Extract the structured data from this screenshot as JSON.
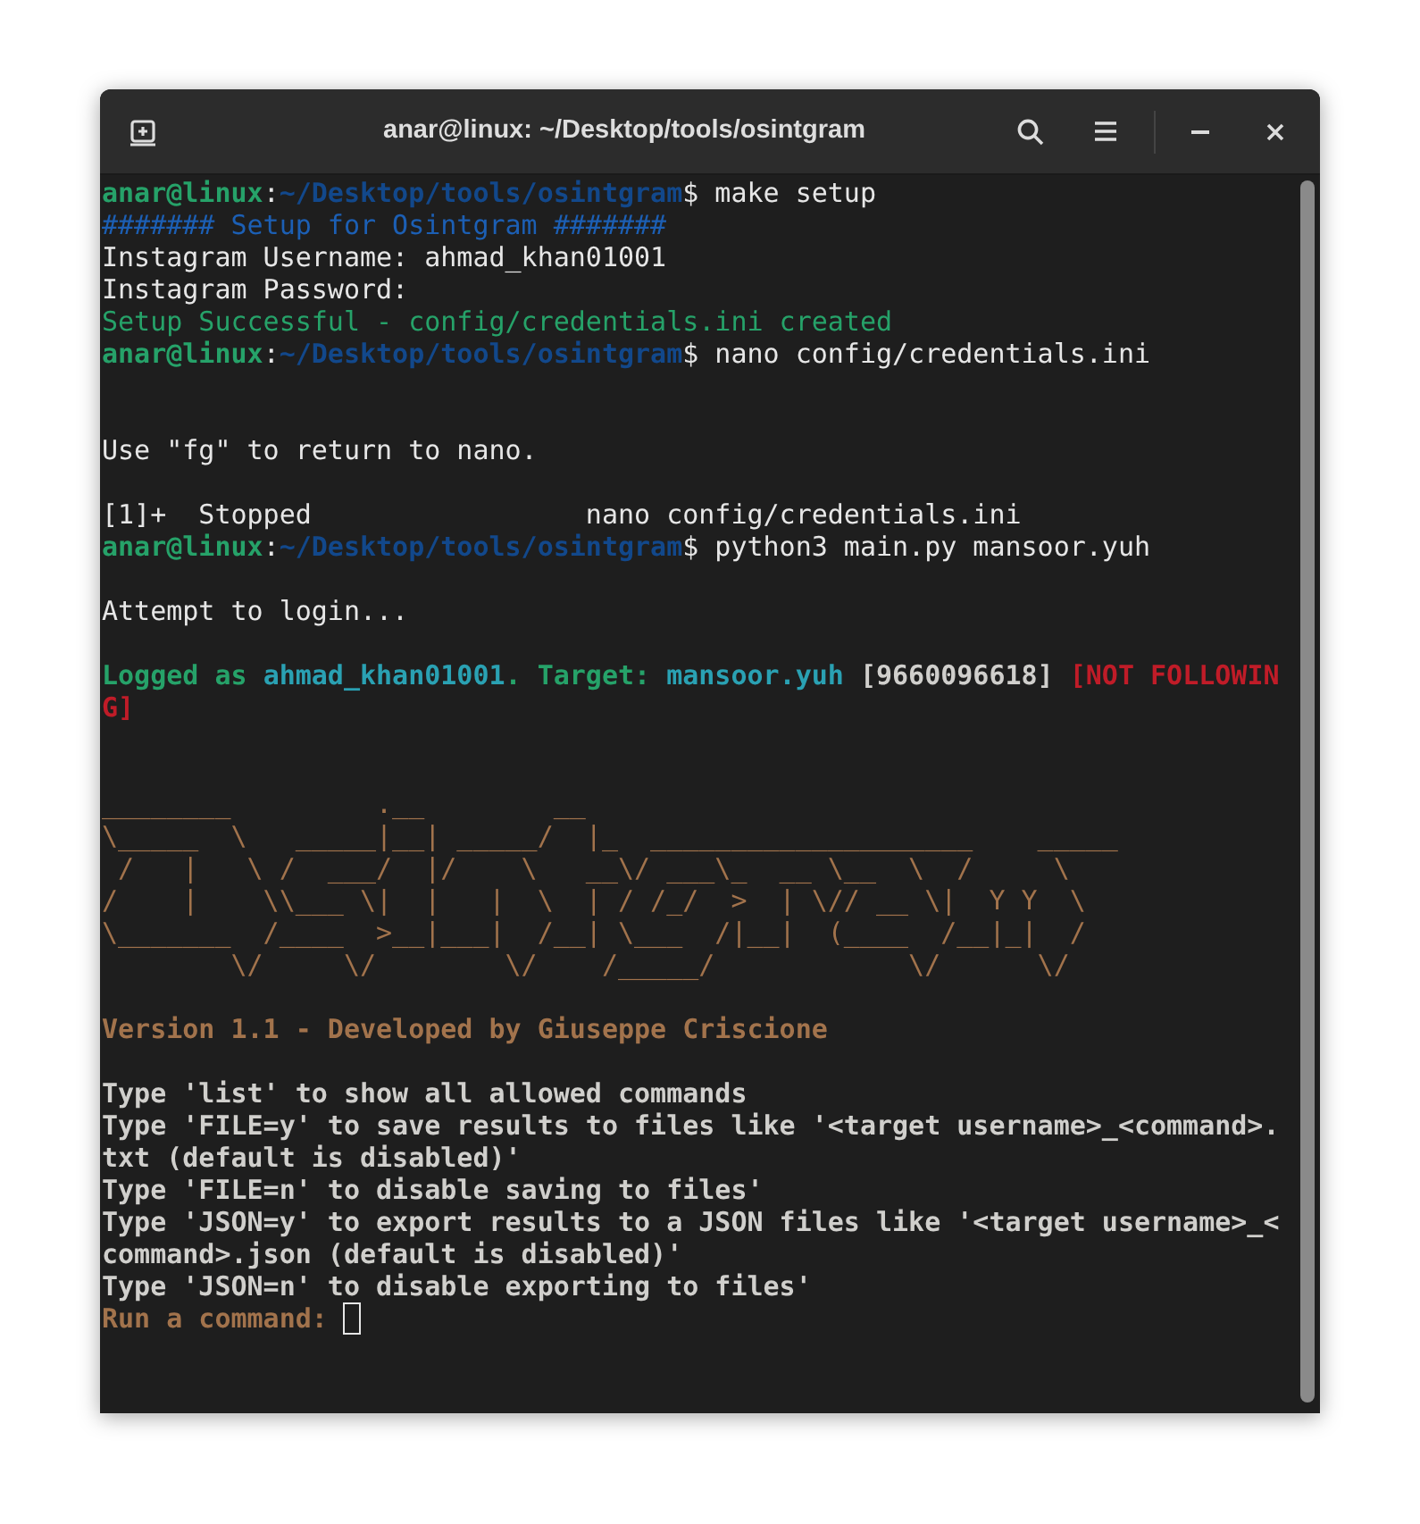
{
  "window": {
    "title": "anar@linux: ~/Desktop/tools/osintgram"
  },
  "terminal": {
    "lines": [
      {
        "kind": "text",
        "segments": [
          {
            "kind": "user",
            "text": "anar@linux"
          },
          {
            "kind": "plain",
            "text": ":"
          },
          {
            "kind": "path",
            "text": "~/Desktop/tools/osintgram"
          },
          {
            "kind": "plain",
            "text": "$ make setup"
          }
        ]
      },
      {
        "kind": "text",
        "segments": [
          {
            "kind": "comment",
            "text": "####### Setup for Osintgram #######"
          }
        ]
      },
      {
        "kind": "text",
        "segments": [
          {
            "kind": "plain",
            "text": "Instagram Username: ahmad_khan01001"
          }
        ]
      },
      {
        "kind": "text",
        "segments": [
          {
            "kind": "plain",
            "text": "Instagram Password:"
          }
        ]
      },
      {
        "kind": "text",
        "segments": [
          {
            "kind": "success",
            "text": "Setup Successful - config/credentials.ini created"
          }
        ]
      },
      {
        "kind": "text",
        "segments": [
          {
            "kind": "user",
            "text": "anar@linux"
          },
          {
            "kind": "plain",
            "text": ":"
          },
          {
            "kind": "path",
            "text": "~/Desktop/tools/osintgram"
          },
          {
            "kind": "plain",
            "text": "$ nano config/credentials.ini"
          }
        ]
      },
      {
        "kind": "blank"
      },
      {
        "kind": "blank"
      },
      {
        "kind": "text",
        "segments": [
          {
            "kind": "plain",
            "text": "Use \"fg\" to return to nano."
          }
        ]
      },
      {
        "kind": "blank"
      },
      {
        "kind": "text",
        "segments": [
          {
            "kind": "plain",
            "text": "[1]+  Stopped                 nano config/credentials.ini"
          }
        ]
      },
      {
        "kind": "text",
        "segments": [
          {
            "kind": "user",
            "text": "anar@linux"
          },
          {
            "kind": "plain",
            "text": ":"
          },
          {
            "kind": "path",
            "text": "~/Desktop/tools/osintgram"
          },
          {
            "kind": "plain",
            "text": "$ python3 main.py mansoor.yuh"
          }
        ]
      },
      {
        "kind": "blank"
      },
      {
        "kind": "text",
        "segments": [
          {
            "kind": "plain",
            "text": "Attempt to login..."
          }
        ]
      },
      {
        "kind": "blank"
      },
      {
        "kind": "text",
        "segments": [
          {
            "kind": "info",
            "text": "Logged as "
          },
          {
            "kind": "account",
            "text": "ahmad_khan01001"
          },
          {
            "kind": "info",
            "text": ". Target: "
          },
          {
            "kind": "account",
            "text": "mansoor.yuh"
          },
          {
            "kind": "bold",
            "text": " [9660096618] "
          },
          {
            "kind": "alert",
            "text": "[NOT FOLLOWIN"
          }
        ]
      },
      {
        "kind": "text",
        "segments": [
          {
            "kind": "alert",
            "text": "G]"
          }
        ]
      },
      {
        "kind": "blank"
      },
      {
        "kind": "blank"
      },
      {
        "kind": "text",
        "segments": [
          {
            "kind": "banner",
            "text": "________         .__        __"
          }
        ]
      },
      {
        "kind": "text",
        "segments": [
          {
            "kind": "banner",
            "text": "\\_____  \\   _____|__| _____/  |_  ____________________    _____"
          }
        ]
      },
      {
        "kind": "text",
        "segments": [
          {
            "kind": "banner",
            "text": " /   |   \\ /  ___/  |/    \\   __\\/ ___\\_  __ \\__  \\  /     \\"
          }
        ]
      },
      {
        "kind": "text",
        "segments": [
          {
            "kind": "banner",
            "text": "/    |    \\\\___ \\|  |   |  \\  | / /_/  >  | \\// __ \\|  Y Y  \\"
          }
        ]
      },
      {
        "kind": "text",
        "segments": [
          {
            "kind": "banner",
            "text": "\\_______  /____  >__|___|  /__| \\___  /|__|  (____  /__|_|  /"
          }
        ]
      },
      {
        "kind": "text",
        "segments": [
          {
            "kind": "banner",
            "text": "        \\/     \\/        \\/    /_____/            \\/      \\/"
          }
        ]
      },
      {
        "kind": "blank"
      },
      {
        "kind": "text",
        "segments": [
          {
            "kind": "version",
            "text": "Version 1.1 - Developed by Giuseppe Criscione"
          }
        ]
      },
      {
        "kind": "blank"
      },
      {
        "kind": "text",
        "segments": [
          {
            "kind": "bold",
            "text": "Type 'list' to show all allowed commands"
          }
        ]
      },
      {
        "kind": "text",
        "segments": [
          {
            "kind": "bold",
            "text": "Type 'FILE=y' to save results to files like '<target username>_<command>."
          }
        ]
      },
      {
        "kind": "text",
        "segments": [
          {
            "kind": "bold",
            "text": "txt (default is disabled)'"
          }
        ]
      },
      {
        "kind": "text",
        "segments": [
          {
            "kind": "bold",
            "text": "Type 'FILE=n' to disable saving to files'"
          }
        ]
      },
      {
        "kind": "text",
        "segments": [
          {
            "kind": "bold",
            "text": "Type 'JSON=y' to export results to a JSON files like '<target username>_<"
          }
        ]
      },
      {
        "kind": "text",
        "segments": [
          {
            "kind": "bold",
            "text": "command>.json (default is disabled)'"
          }
        ]
      },
      {
        "kind": "text",
        "segments": [
          {
            "kind": "bold",
            "text": "Type 'JSON=n' to disable exporting to files'"
          }
        ]
      },
      {
        "kind": "text",
        "cursor": true,
        "segments": [
          {
            "kind": "version",
            "text": "Run a command: "
          }
        ]
      }
    ]
  }
}
